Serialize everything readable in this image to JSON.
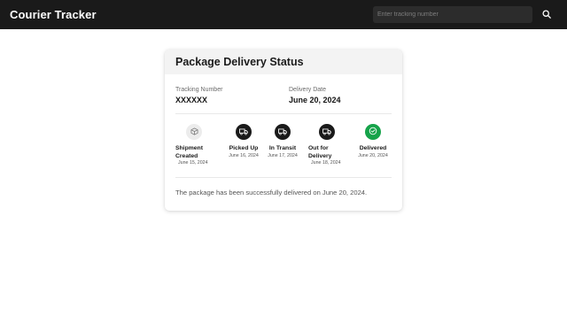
{
  "app": {
    "title": "Courier Tracker"
  },
  "search": {
    "placeholder": "Enter tracking number",
    "value": ""
  },
  "card": {
    "title": "Package Delivery Status",
    "tracking_label": "Tracking Number",
    "tracking_value": "XXXXXX",
    "delivery_label": "Delivery Date",
    "delivery_value": "June 20, 2024",
    "message": "The package has been successfully delivered on June 20, 2024."
  },
  "steps": [
    {
      "label": "Shipment Created",
      "date": "June 15, 2024",
      "icon": "package-icon",
      "status": "pending"
    },
    {
      "label": "Picked Up",
      "date": "June 16, 2024",
      "icon": "truck-icon",
      "status": "done"
    },
    {
      "label": "In Transit",
      "date": "June 17, 2024",
      "icon": "truck-icon",
      "status": "done"
    },
    {
      "label": "Out for Delivery",
      "date": "June 18, 2024",
      "icon": "truck-icon",
      "status": "done"
    },
    {
      "label": "Delivered",
      "date": "June 20, 2024",
      "icon": "check-circle-icon",
      "status": "complete"
    }
  ],
  "colors": {
    "topbar": "#1a1a1a",
    "step_done": "#1a1a1a",
    "step_pending": "#ececec",
    "step_complete": "#16a34a"
  }
}
